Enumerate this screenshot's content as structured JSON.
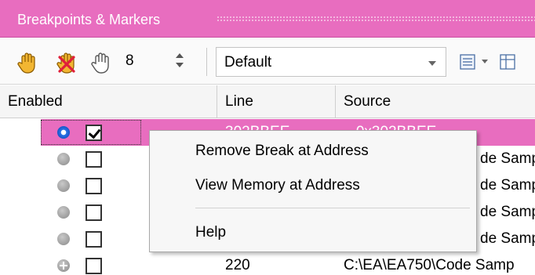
{
  "panel": {
    "title": "Breakpoints & Markers"
  },
  "toolbar": {
    "icons": [
      "hand-icon",
      "hand-delete-icon",
      "hand-outline-icon"
    ],
    "spinner_value": "8",
    "combo_value": "Default",
    "right_icons": [
      "list-view-icon",
      "grid-view-icon"
    ]
  },
  "table": {
    "columns": [
      "Enabled",
      "Line",
      "Source"
    ],
    "rows": [
      {
        "state": "blue",
        "checked": true,
        "line": "302BBEE",
        "source": "...0x302BBEE",
        "selected": true
      },
      {
        "state": "gray",
        "checked": false,
        "line": "",
        "source": "de Samp"
      },
      {
        "state": "gray",
        "checked": false,
        "line": "",
        "source": "de Samp"
      },
      {
        "state": "gray",
        "checked": false,
        "line": "",
        "source": "de Samp"
      },
      {
        "state": "gray",
        "checked": false,
        "line": "",
        "source": "de Samp"
      },
      {
        "state": "plus",
        "checked": false,
        "line": "220",
        "source": "C:\\EA\\EA750\\Code Samp"
      }
    ]
  },
  "context_menu": {
    "items": [
      "Remove Break at Address",
      "View Memory at Address",
      "Help"
    ]
  },
  "colors": {
    "accent": "#e86dbf",
    "breakpoint_active": "#2d74e6",
    "breakpoint_inactive": "#9a9a9a"
  }
}
